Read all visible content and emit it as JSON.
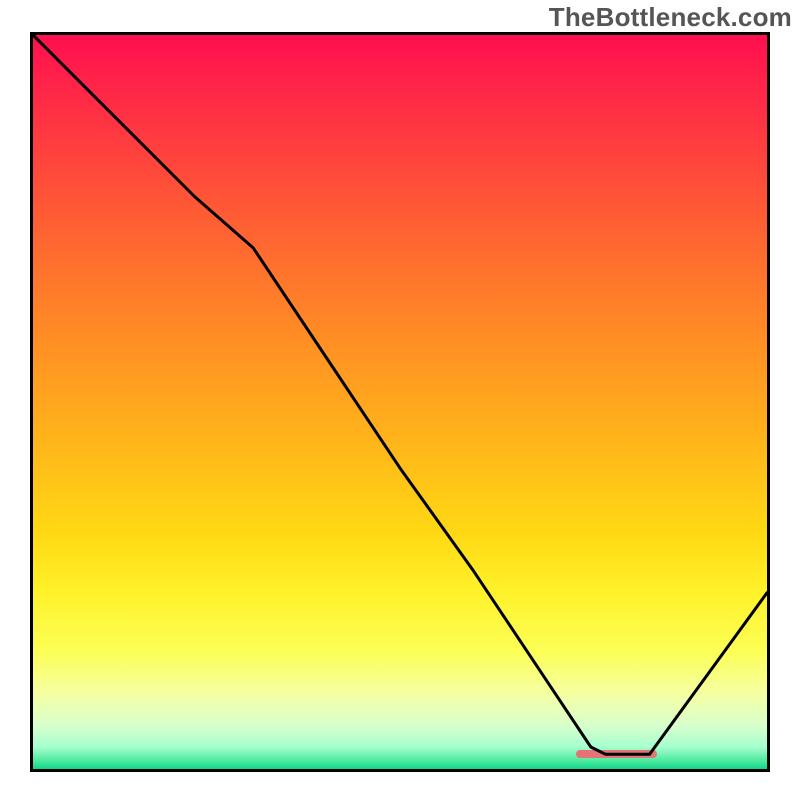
{
  "watermark": "TheBottleneck.com",
  "chart_data": {
    "type": "line",
    "title": "",
    "xlabel": "",
    "ylabel": "",
    "xlim": [
      0,
      100
    ],
    "ylim": [
      0,
      100
    ],
    "grid": false,
    "legend": false,
    "background": "rainbow-heat-gradient",
    "series": [
      {
        "name": "bottleneck-curve",
        "x": [
          0,
          10,
          22,
          30,
          40,
          50,
          60,
          70,
          76,
          78,
          84,
          100
        ],
        "y": [
          100,
          90,
          78,
          71,
          56,
          41,
          27,
          12,
          3,
          2,
          2,
          24
        ],
        "stroke": "#000000",
        "stroke_width": 3
      }
    ],
    "highlight_segment": {
      "name": "optimal-range-marker",
      "x_start": 74,
      "x_end": 85,
      "y": 2,
      "color": "#e57373"
    }
  }
}
